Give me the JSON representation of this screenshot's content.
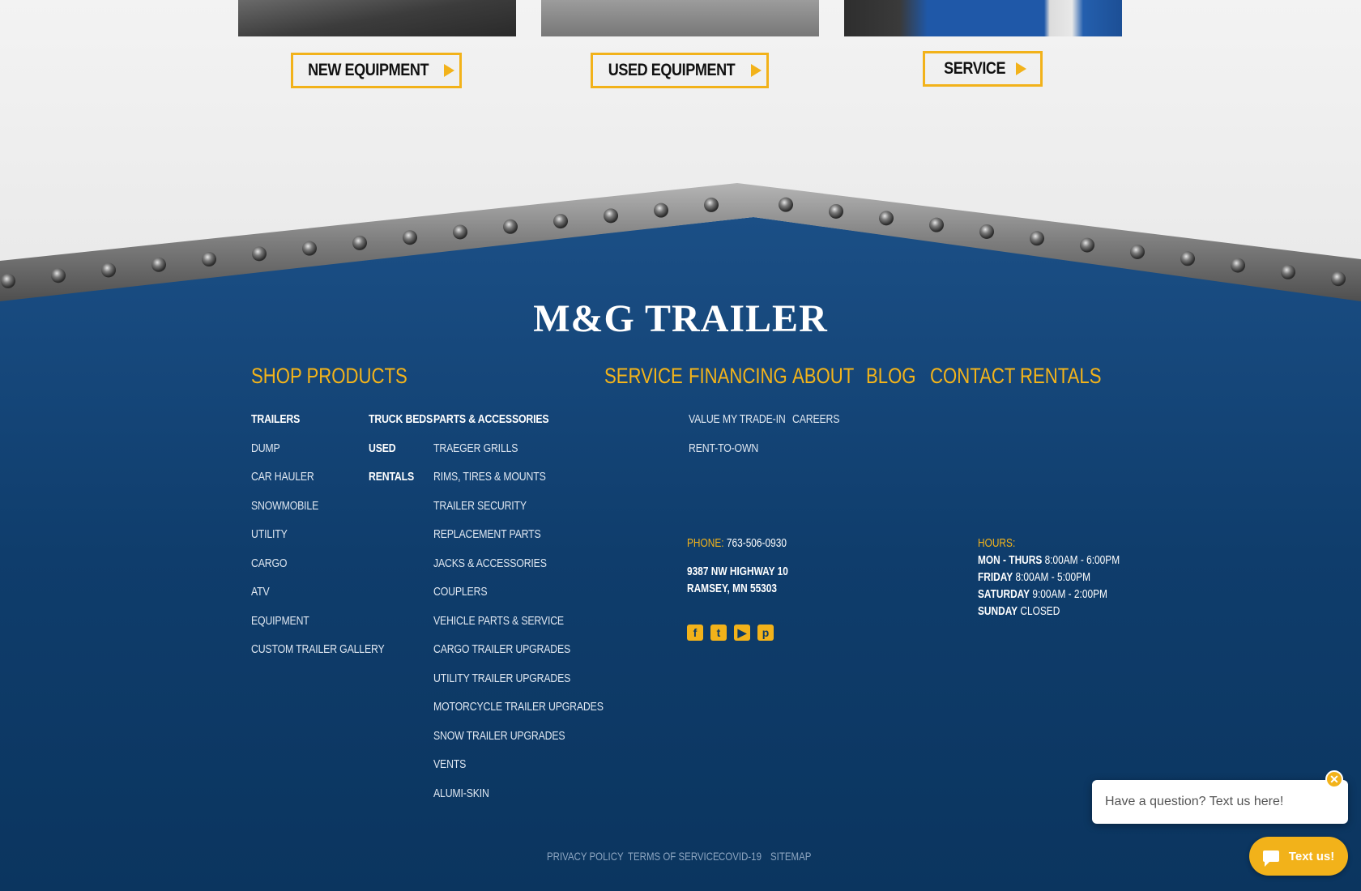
{
  "ctas": {
    "new_equipment": "NEW EQUIPMENT",
    "used_equipment": "USED EQUIPMENT",
    "service": "SERVICE"
  },
  "footer": {
    "logo": "M&G TRAILER",
    "nav": {
      "shop_products": "SHOP PRODUCTS",
      "service": "SERVICE",
      "financing": "FINANCING",
      "about": "ABOUT",
      "blog": "BLOG",
      "contact": "CONTACT",
      "rentals": "RENTALS"
    },
    "trailers": {
      "heading": "TRAILERS",
      "items": [
        "DUMP",
        "CAR HAULER",
        "SNOWMOBILE",
        "UTILITY",
        "CARGO",
        "ATV",
        "EQUIPMENT",
        "CUSTOM TRAILER GALLERY"
      ]
    },
    "other_links": {
      "truck_beds": "TRUCK BEDS",
      "used": "USED",
      "rentals": "RENTALS"
    },
    "parts": {
      "heading": "PARTS & ACCESSORIES",
      "items": [
        "TRAEGER GRILLS",
        "RIMS, TIRES & MOUNTS",
        "TRAILER SECURITY",
        "REPLACEMENT PARTS",
        "JACKS & ACCESSORIES",
        "COUPLERS",
        "VEHICLE PARTS & SERVICE",
        "CARGO TRAILER UPGRADES",
        "UTILITY TRAILER UPGRADES",
        "MOTORCYCLE TRAILER UPGRADES",
        "SNOW TRAILER UPGRADES",
        "VENTS",
        "ALUMI-SKIN"
      ]
    },
    "financing_items": [
      "VALUE MY TRADE-IN",
      "RENT-TO-OWN"
    ],
    "about_items": [
      "CAREERS"
    ],
    "contact": {
      "phone_label": "PHONE:",
      "phone": "763-506-0930",
      "address_line1": "9387 NW HIGHWAY 10",
      "address_line2": "RAMSEY, MN 55303"
    },
    "hours": {
      "label": "HOURS:",
      "rows": [
        {
          "day": "MON - THURS",
          "time": "8:00AM - 6:00PM"
        },
        {
          "day": "FRIDAY",
          "time": "8:00AM - 5:00PM"
        },
        {
          "day": "SATURDAY",
          "time": "9:00AM - 2:00PM"
        },
        {
          "day": "SUNDAY",
          "time": "CLOSED"
        }
      ]
    },
    "social_icons": [
      "facebook-icon",
      "twitter-icon",
      "youtube-icon",
      "pinterest-icon"
    ],
    "legal": {
      "privacy": "PRIVACY POLICY",
      "terms": "TERMS OF SERVICE",
      "covid": "COVID-19",
      "sitemap": "SITEMAP"
    }
  },
  "chat": {
    "prompt": "Have a question? Text us here!",
    "button": "Text us!",
    "close_glyph": "✕"
  },
  "colors": {
    "accent": "#f2b21a",
    "footer_blue": "#0e3a66",
    "steel": "#8a8a8a"
  }
}
